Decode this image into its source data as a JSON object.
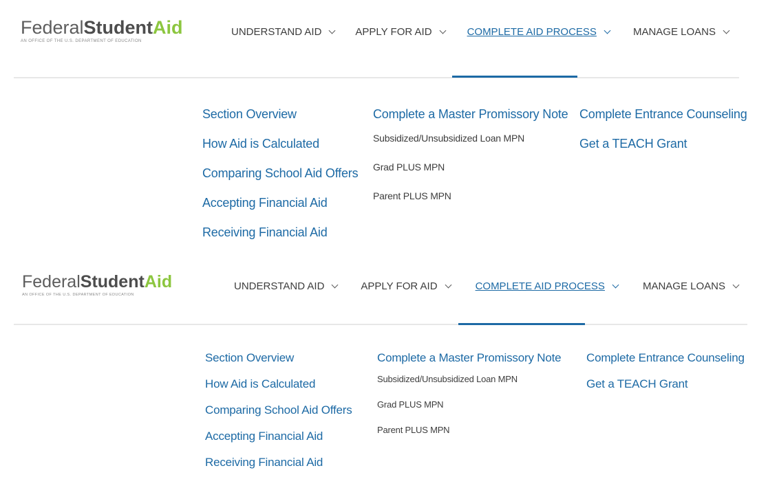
{
  "logo": {
    "federal": "Federal",
    "student": "Student",
    "aid": "Aid",
    "tagline": "An OFFICE of the U.S. DEPARTMENT of EDUCATION"
  },
  "nav": {
    "understand": "UNDERSTAND AID",
    "apply": "APPLY FOR AID",
    "complete": "COMPLETE AID PROCESS",
    "manage": "MANAGE LOANS"
  },
  "menu": {
    "col1": [
      "Section Overview",
      "How Aid is Calculated",
      "Comparing School Aid Offers",
      "Accepting Financial Aid",
      "Receiving Financial Aid"
    ],
    "col2_heading": "Complete a Master Promissory Note",
    "col2_items": [
      "Subsidized/Unsubsidized Loan MPN",
      "Grad PLUS MPN",
      "Parent PLUS MPN"
    ],
    "col3": [
      "Complete Entrance Counseling",
      "Get a TEACH Grant"
    ]
  },
  "colors": {
    "link_blue": "#1d6aa5",
    "logo_green": "#8cc63f",
    "text_dark": "#3d3d3d",
    "rule_gray": "#e7e7e7"
  },
  "icons": {
    "nav_chevron": "chevron-down-icon"
  }
}
